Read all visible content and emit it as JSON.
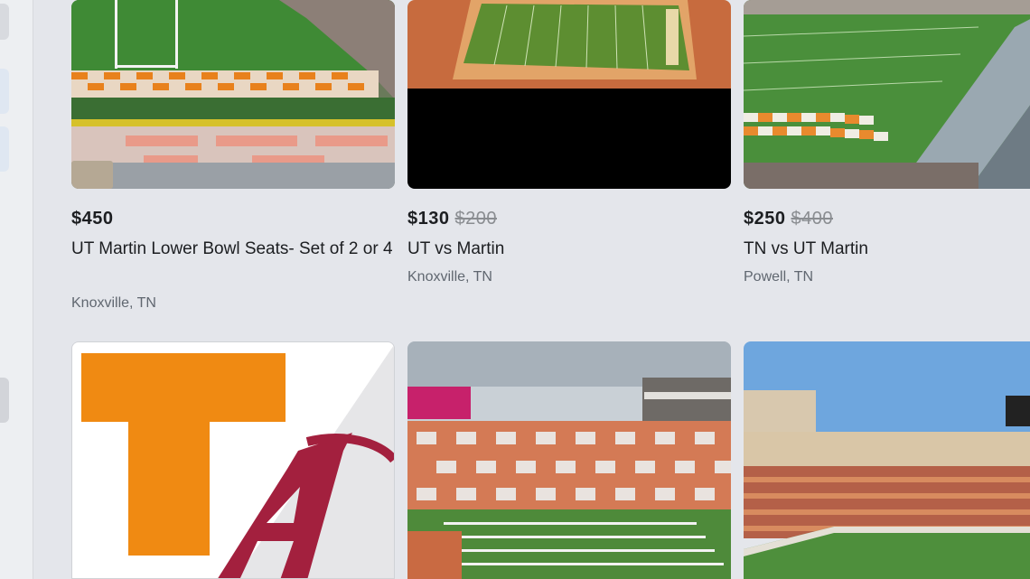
{
  "listings": [
    {
      "price": "$450",
      "old_price": "",
      "title": "UT Martin Lower Bowl Seats- Set of 2 or 4",
      "location": "Knoxville, TN",
      "image": "stadium-photo"
    },
    {
      "price": "$130",
      "old_price": "$200",
      "title": "UT vs Martin",
      "location": "Knoxville, TN",
      "image": "stadium-aerial-photo"
    },
    {
      "price": "$250",
      "old_price": "$400",
      "title": "TN vs UT Martin",
      "location": "Powell, TN",
      "image": "field-photo"
    },
    {
      "image": "tennessee-alabama-logos"
    },
    {
      "image": "stadium-checkerboard-photo"
    },
    {
      "image": "stadium-crowd-photo"
    }
  ],
  "colors": {
    "tennessee_orange": "#f07f0b",
    "alabama_crimson": "#a3203e",
    "page_bg": "#e4e6eb"
  }
}
